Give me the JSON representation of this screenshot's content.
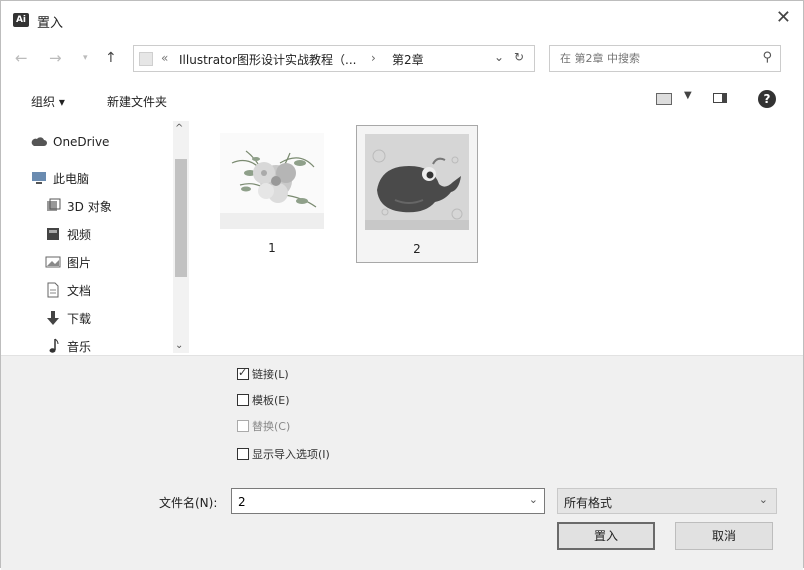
{
  "window": {
    "icon_text": "Ai",
    "title": "置入"
  },
  "address": {
    "prefix": "«",
    "segment1": "Illustrator图形设计实战教程（...",
    "separator": "›",
    "segment2": "第2章"
  },
  "search": {
    "placeholder": "在 第2章 中搜索"
  },
  "toolbar": {
    "organize_label": "组织 ▾",
    "new_folder_label": "新建文件夹",
    "help_label": "?"
  },
  "sidebar": {
    "items": [
      {
        "label": "OneDrive"
      },
      {
        "label": "此电脑"
      },
      {
        "label": "3D 对象"
      },
      {
        "label": "视频"
      },
      {
        "label": "图片"
      },
      {
        "label": "文档"
      },
      {
        "label": "下载"
      },
      {
        "label": "音乐"
      }
    ]
  },
  "files": [
    {
      "name": "1"
    },
    {
      "name": "2"
    }
  ],
  "options": {
    "link": {
      "label": "链接(L)",
      "checked": true
    },
    "template": {
      "label": "模板(E)",
      "checked": false
    },
    "replace": {
      "label": "替换(C)",
      "checked": false,
      "disabled": true
    },
    "show_import": {
      "label": "显示导入选项(I)",
      "checked": false
    }
  },
  "filename": {
    "label": "文件名(N):",
    "value": "2"
  },
  "filter": {
    "value": "所有格式"
  },
  "buttons": {
    "place": "置入",
    "cancel": "取消"
  }
}
